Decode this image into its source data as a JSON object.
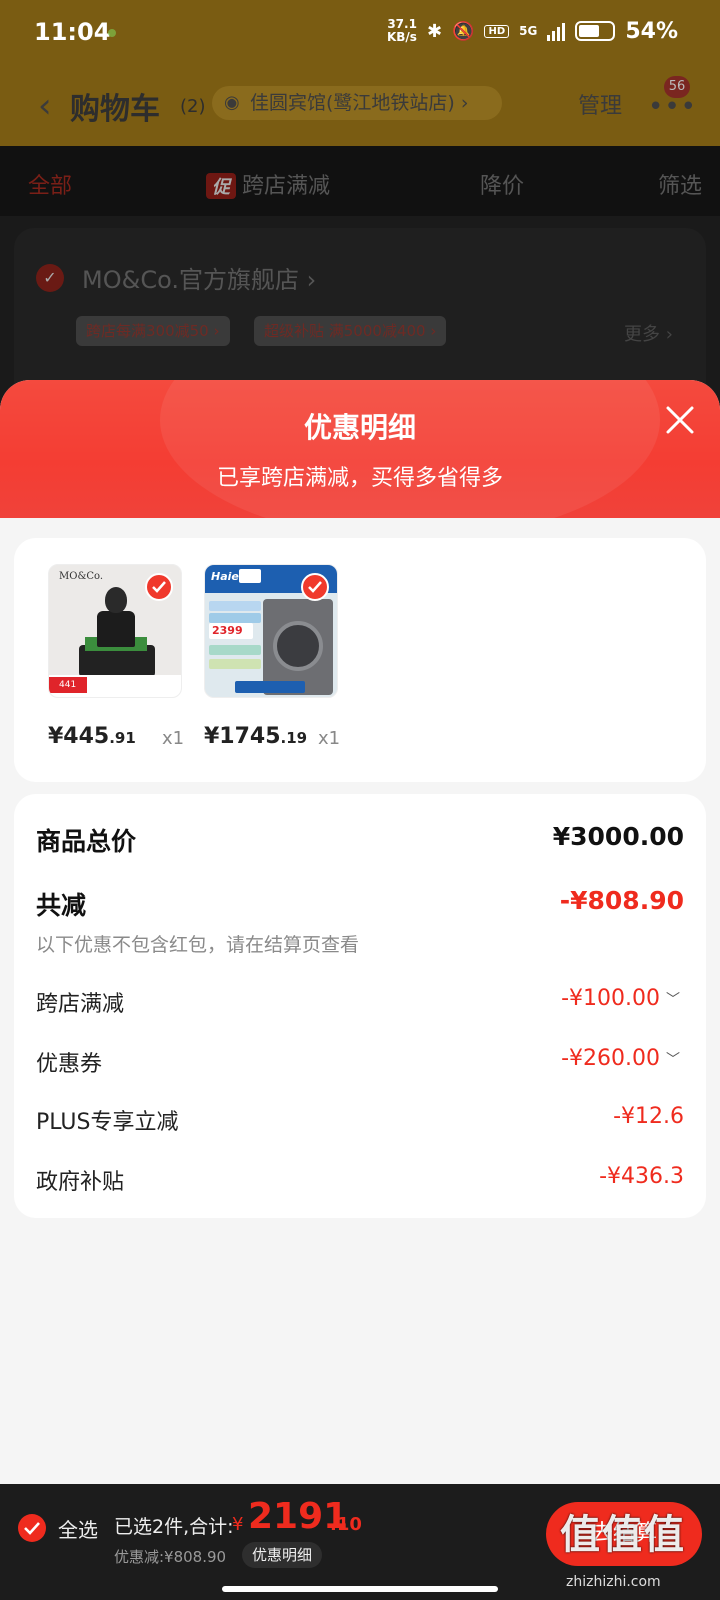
{
  "status_bar": {
    "time": "11:04",
    "speed_top": "37.1",
    "speed_unit": "KB/s",
    "battery": "54%",
    "network": "5G"
  },
  "header": {
    "back_icon": "chevron-left-icon",
    "title": "购物车",
    "count": "(2)",
    "location": "佳圆宾馆(鹭江地铁站店)",
    "manage": "管理",
    "badge": "56"
  },
  "tabs": {
    "all": "全部",
    "promo_badge": "促",
    "cross_store": "跨店满减",
    "price_drop": "降价",
    "filter": "筛选"
  },
  "store": {
    "name": "MO&Co.官方旗舰店",
    "tags": [
      "跨店每满300减50",
      "超级补贴 满5000减400"
    ],
    "more": "更多"
  },
  "sheet": {
    "title": "优惠明细",
    "subtitle": "已享跨店满减，买得多省得多",
    "products": [
      {
        "price_int": "¥445",
        "price_dec": ".91",
        "qty": "x1",
        "thumb_logo": "MO&Co.",
        "thumb_tag": "441"
      },
      {
        "price_int": "¥1745",
        "price_dec": ".19",
        "qty": "x1",
        "thumb_logo": "Haier",
        "thumb_tag": "2399"
      }
    ],
    "summary": {
      "total_label": "商品总价",
      "total_value": "¥3000.00",
      "reduce_label": "共减",
      "reduce_value": "-¥808.90",
      "note": "以下优惠不包含红包，请在结算页查看",
      "items": [
        {
          "label": "跨店满减",
          "value": "-¥100.00",
          "expandable": true
        },
        {
          "label": "优惠券",
          "value": "-¥260.00",
          "expandable": true
        },
        {
          "label": "PLUS专享立减",
          "value": "-¥12.6",
          "expandable": false
        },
        {
          "label": "政府补贴",
          "value": "-¥436.3",
          "expandable": false
        }
      ]
    }
  },
  "bottom_bar": {
    "select_all": "全选",
    "selected": "已选2件,合计:",
    "yen": "¥",
    "total_int": "2191",
    "total_dec": ".10",
    "discount": "优惠减:¥808.90",
    "detail_button": "优惠明细",
    "checkout": "去结算",
    "watermark": "值值值",
    "watermark_url": "zhizhizhi.com"
  },
  "colors": {
    "accent_red": "#ef2b1e",
    "header_dim": "#7a5c12"
  }
}
